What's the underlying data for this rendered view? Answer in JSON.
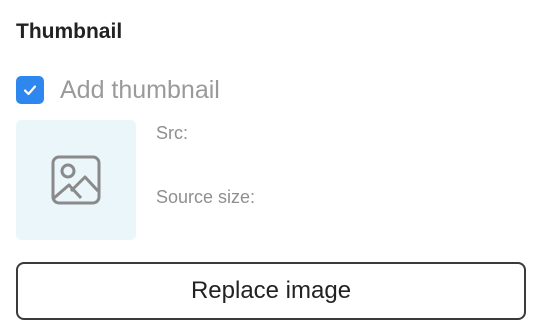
{
  "section": {
    "title": "Thumbnail"
  },
  "checkbox": {
    "label": "Add thumbnail",
    "checked": true,
    "color": "#2d87ee"
  },
  "thumbnail": {
    "icon": "image-placeholder-icon",
    "background": "#eaf6fa"
  },
  "meta": {
    "src_label": "Src:",
    "size_label": "Source size:"
  },
  "actions": {
    "replace_label": "Replace image"
  }
}
